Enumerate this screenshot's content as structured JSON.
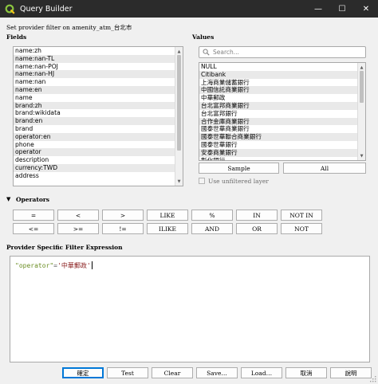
{
  "window": {
    "title": "Query Builder"
  },
  "provider_filter_label": "Set provider filter on amenity_atm_台北市",
  "fields": {
    "label": "Fields",
    "items": [
      "name:zh",
      "name:nan-TL",
      "name:nan-POJ",
      "name:nan-HJ",
      "name:nan",
      "name:en",
      "name",
      "brand:zh",
      "brand:wikidata",
      "brand:en",
      "brand",
      "operator:en",
      "phone",
      "operator",
      "description",
      "currency:TWD",
      "address"
    ]
  },
  "values": {
    "label": "Values",
    "search_placeholder": "Search...",
    "items": [
      "NULL",
      "Citibank",
      "上海商業儲蓄銀行",
      "中國信託商業銀行",
      "中華郵政",
      "台北富邦商業銀行",
      "台北富邦銀行",
      "合作金庫商業銀行",
      "國泰世華商業銀行",
      "國泰世華聯合商業銀行",
      "國泰世華銀行",
      "安泰商業銀行",
      "彰化銀行"
    ],
    "sample_button": "Sample",
    "all_button": "All",
    "use_unfiltered_label": "Use unfiltered layer",
    "use_unfiltered_checked": false
  },
  "operators": {
    "label": "Operators",
    "row1": [
      "=",
      "<",
      ">",
      "LIKE",
      "%",
      "IN",
      "NOT IN"
    ],
    "row2": [
      "<=",
      ">=",
      "!=",
      "ILIKE",
      "AND",
      "OR",
      "NOT"
    ]
  },
  "expression": {
    "label": "Provider Specific Filter Expression",
    "field": "\"operator\"",
    "operator": "=",
    "value": "'中華郵政'"
  },
  "buttons": {
    "ok": "確定",
    "test": "Test",
    "clear": "Clear",
    "save": "Save…",
    "load": "Load…",
    "cancel": "取消",
    "help": "說明"
  },
  "colors": {
    "titlebar": "#2b2b2b",
    "expr_field": "#6b8e23",
    "expr_value": "#8b2020",
    "default_button_border": "#0078d7"
  }
}
